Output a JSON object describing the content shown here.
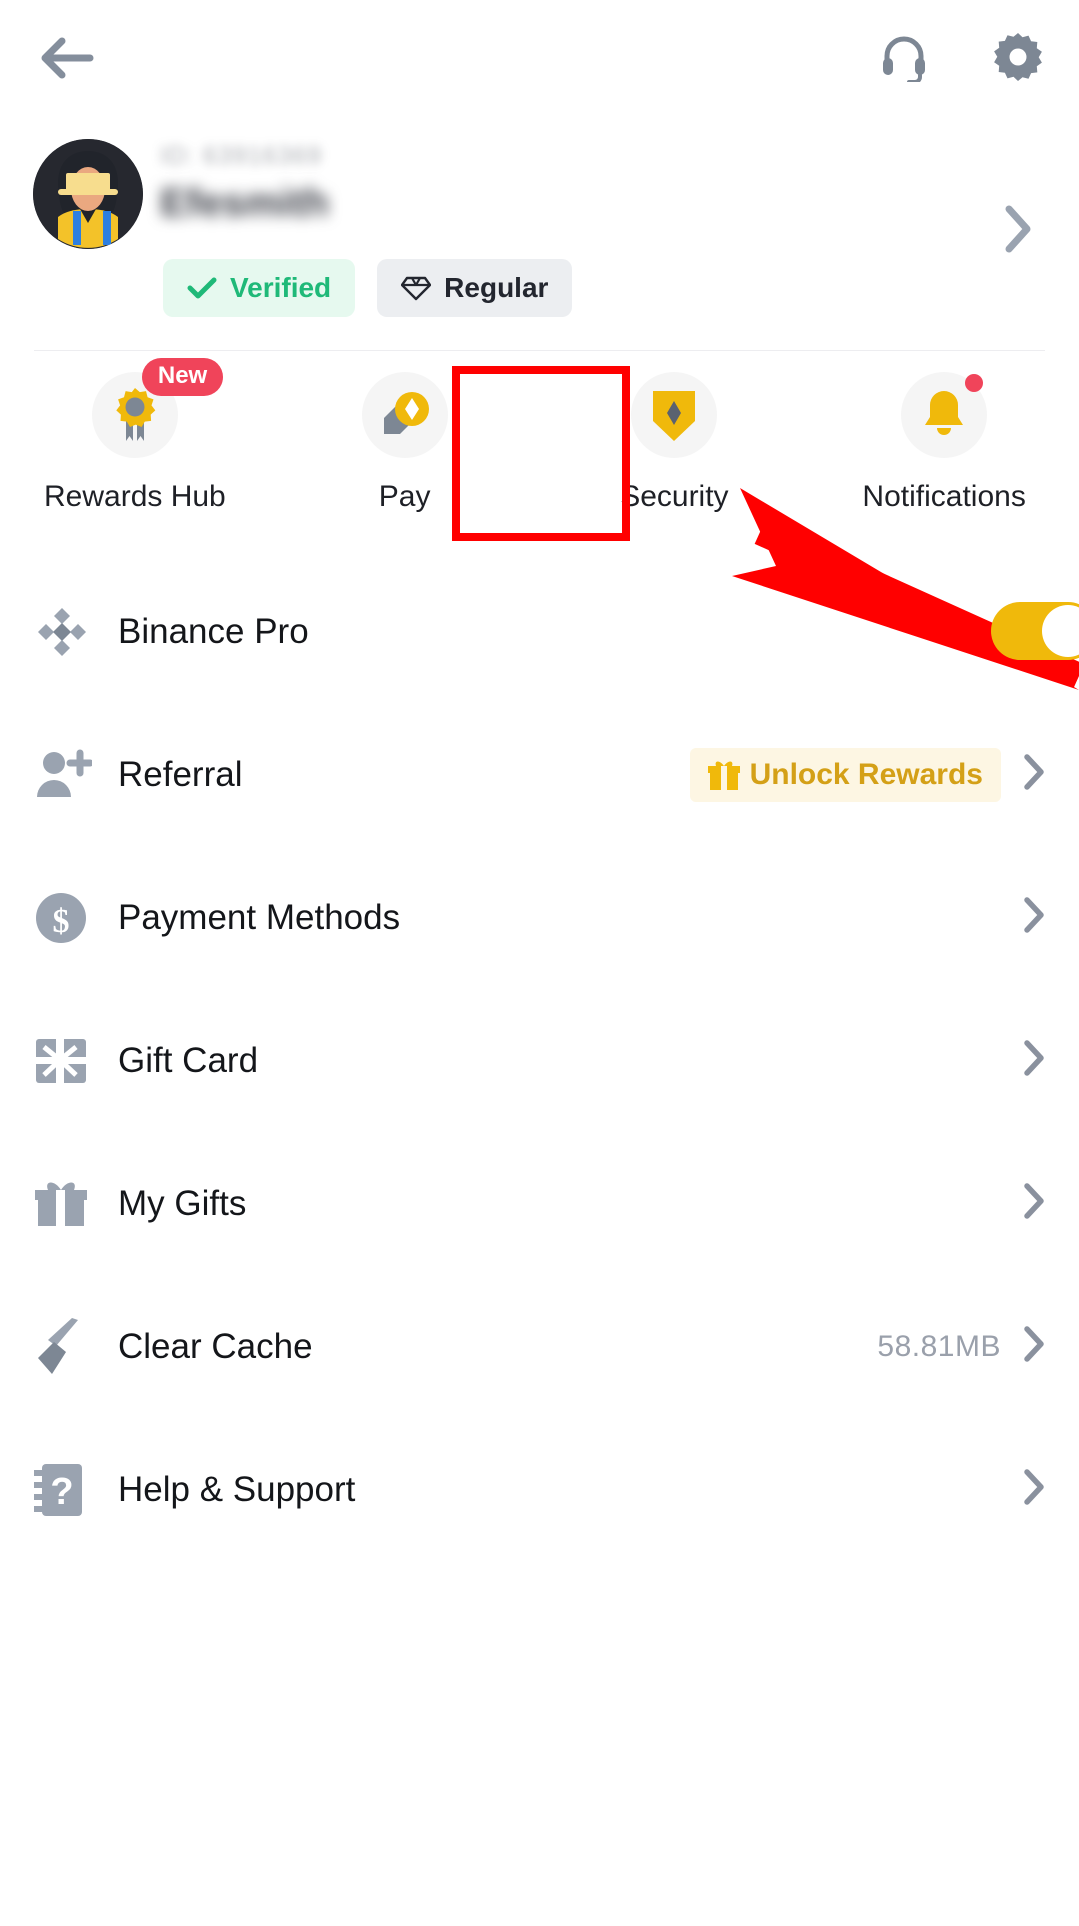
{
  "header": {
    "back_icon": "back-arrow-icon",
    "support_icon": "headset-icon",
    "settings_icon": "gear-icon"
  },
  "profile": {
    "uid": "ID: 63916369",
    "username": "Efesmith",
    "avatar_icon": "user-avatar",
    "chevron_icon": "chevron-right-icon",
    "badges": [
      {
        "label": "Verified",
        "icon": "check-icon",
        "color": "#1fb978",
        "bg": "#e6f9ef"
      },
      {
        "label": "Regular",
        "icon": "diamond-icon",
        "color": "#23262f",
        "bg": "#eceef1"
      }
    ]
  },
  "quick_actions": [
    {
      "label": "Rewards Hub",
      "icon": "medal-icon",
      "badge": "New",
      "dot": false
    },
    {
      "label": "Pay",
      "icon": "pay-icon",
      "badge": null,
      "dot": false
    },
    {
      "label": "Security",
      "icon": "shield-icon",
      "badge": null,
      "dot": false
    },
    {
      "label": "Notifications",
      "icon": "bell-icon",
      "badge": null,
      "dot": true
    }
  ],
  "annotation": {
    "highlight_target": "Security",
    "color": "#ff0000"
  },
  "menu": [
    {
      "label": "Binance Pro",
      "icon": "binance-logo-icon",
      "control": "toggle",
      "toggle_on": true,
      "value": null,
      "pill": null,
      "chevron": false
    },
    {
      "label": "Referral",
      "icon": "add-user-icon",
      "control": "pill",
      "toggle_on": false,
      "value": null,
      "pill": "Unlock Rewards",
      "chevron": true
    },
    {
      "label": "Payment Methods",
      "icon": "dollar-circle-icon",
      "control": "none",
      "toggle_on": false,
      "value": null,
      "pill": null,
      "chevron": true
    },
    {
      "label": "Gift Card",
      "icon": "gift-card-icon",
      "control": "none",
      "toggle_on": false,
      "value": null,
      "pill": null,
      "chevron": true
    },
    {
      "label": "My Gifts",
      "icon": "gift-box-icon",
      "control": "none",
      "toggle_on": false,
      "value": null,
      "pill": null,
      "chevron": true
    },
    {
      "label": "Clear Cache",
      "icon": "broom-icon",
      "control": "value",
      "toggle_on": false,
      "value": "58.81MB",
      "pill": null,
      "chevron": true
    },
    {
      "label": "Help & Support",
      "icon": "question-badge-icon",
      "control": "none",
      "toggle_on": false,
      "value": null,
      "pill": null,
      "chevron": true
    }
  ],
  "colors": {
    "brand_yellow": "#f0b90b",
    "accent_red": "#f0445a",
    "verified_green": "#1fb978",
    "text_primary": "#14161a",
    "text_muted": "#9aa0ab",
    "annotation_red": "#ff0000"
  }
}
